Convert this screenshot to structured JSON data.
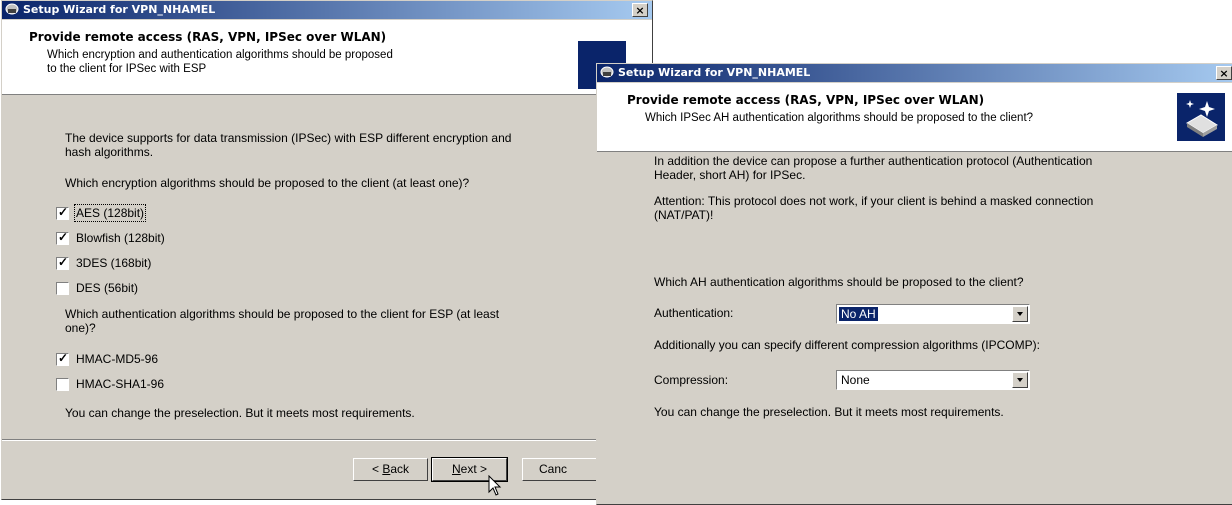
{
  "window1": {
    "title": "Setup Wizard for VPN_NHAMEL",
    "close": "×",
    "header_title": "Provide remote access (RAS, VPN, IPSec over WLAN)",
    "header_sub1": "Which encryption and authentication algorithms should be proposed",
    "header_sub2": "to the client for IPSec with ESP",
    "intro1": "The device supports for data transmission (IPSec) with ESP different encryption and",
    "intro2": "hash algorithms.",
    "enc_question": "Which encryption algorithms should be proposed to the client (at least one)?",
    "encryption": [
      {
        "label": "AES (128bit)",
        "checked": true
      },
      {
        "label": "Blowfish (128bit)",
        "checked": true
      },
      {
        "label": "3DES (168bit)",
        "checked": true
      },
      {
        "label": "DES (56bit)",
        "checked": false
      }
    ],
    "auth_question1": "Which authentication algorithms should be proposed to the client for ESP (at least",
    "auth_question2": "one)?",
    "authentication": [
      {
        "label": "HMAC-MD5-96",
        "checked": true
      },
      {
        "label": "HMAC-SHA1-96",
        "checked": false
      }
    ],
    "footer_note": "You can change the preselection. But it meets most requirements.",
    "back_pre": "< ",
    "back_key": "B",
    "back_post": "ack",
    "next_key": "N",
    "next_post": "ext >",
    "cancel_label": "Canc"
  },
  "window2": {
    "title": "Setup Wizard for VPN_NHAMEL",
    "close": "×",
    "header_title": "Provide remote access (RAS, VPN, IPSec over WLAN)",
    "header_sub": "Which IPSec AH authentication algorithms should be proposed to the client?",
    "intro1": "In addition the device can propose a further authentication protocol (Authentication",
    "intro2": "Header, short AH) for IPSec.",
    "attention1": "Attention: This protocol does not work, if your client is behind a masked connection",
    "attention2": "(NAT/PAT)!",
    "ah_question": "Which AH authentication algorithms should be proposed to the client?",
    "auth_label": "Authentication:",
    "auth_value": "No AH",
    "ipcomp_text": "Additionally you can specify different compression algorithms (IPCOMP):",
    "comp_label": "Compression:",
    "comp_value": "None",
    "footer_note": "You can change the preselection. But it meets most requirements."
  },
  "colors": {
    "titlebar_start": "#0a246a",
    "titlebar_end": "#a6caf0",
    "dialog_bg": "#d4d0c8",
    "selection": "#0a246a"
  },
  "icons": [
    "app-icon",
    "wizard-network-icon",
    "close-icon",
    "checkmark-icon",
    "dropdown-arrow-icon",
    "mouse-cursor-icon"
  ]
}
